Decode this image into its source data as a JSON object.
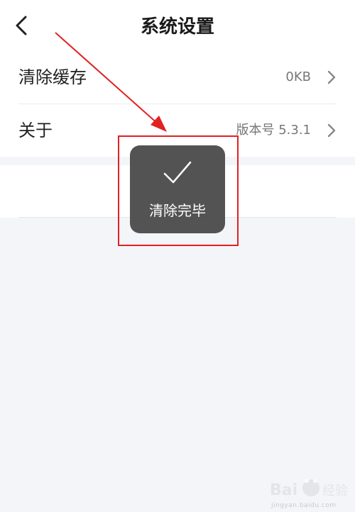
{
  "header": {
    "title": "系统设置",
    "back_icon": "chevron-left-icon"
  },
  "settings": [
    {
      "label": "清除缓存",
      "value": "0KB",
      "icon": "chevron-right-icon"
    },
    {
      "label": "关于",
      "value": "版本号 5.3.1",
      "icon": "chevron-right-icon"
    }
  ],
  "toast": {
    "icon": "checkmark-icon",
    "text": "清除完毕"
  },
  "annotation": {
    "color": "#e02222"
  },
  "watermark": {
    "brand": "Baidu 经验",
    "url": "jingyan.baidu.com"
  },
  "colors": {
    "background": "#f4f5f9",
    "toast_bg": "#464646"
  }
}
